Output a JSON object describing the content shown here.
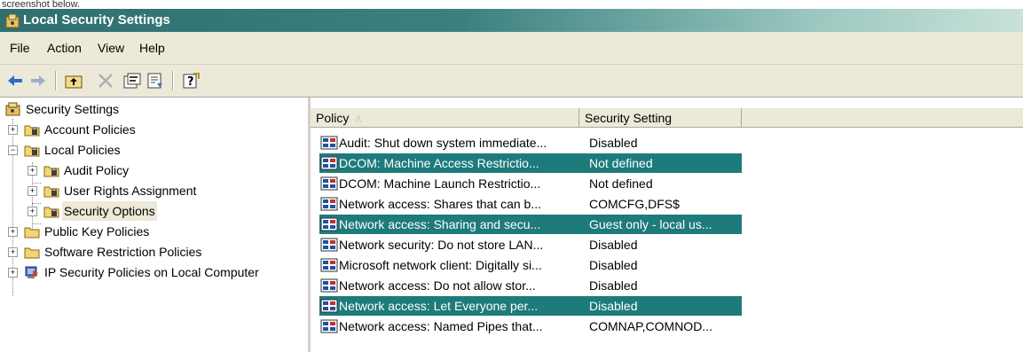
{
  "caption": "screenshot below.",
  "window": {
    "title": "Local Security Settings"
  },
  "menu": [
    "File",
    "Action",
    "View",
    "Help"
  ],
  "toolbar": {
    "buttons": [
      "back-icon",
      "forward-icon",
      "up-folder-icon",
      "delete-icon",
      "properties-icon",
      "export-list-icon",
      "help-icon"
    ]
  },
  "tree": {
    "items": [
      {
        "label": "Security Settings",
        "icon": "security-settings-icon"
      },
      {
        "label": "Account Policies",
        "icon": "folder-policy-icon",
        "expander": "+"
      },
      {
        "label": "Local Policies",
        "icon": "folder-policy-icon",
        "expander": "−"
      },
      {
        "label": "Audit Policy",
        "icon": "folder-policy-icon",
        "expander": "+"
      },
      {
        "label": "User Rights Assignment",
        "icon": "folder-policy-icon",
        "expander": "+"
      },
      {
        "label": "Security Options",
        "icon": "folder-policy-icon",
        "expander": "+",
        "selected": true
      },
      {
        "label": "Public Key Policies",
        "icon": "folder-icon",
        "expander": "+"
      },
      {
        "label": "Software Restriction Policies",
        "icon": "folder-icon",
        "expander": "+"
      },
      {
        "label": "IP Security Policies on Local Computer",
        "icon": "ip-security-icon",
        "expander": "+"
      }
    ]
  },
  "list": {
    "columns": [
      "Policy",
      "Security Setting"
    ],
    "sort_indicator": "/\\",
    "rows": [
      {
        "policy": "Audit: Shut down system immediate...",
        "setting": "Disabled",
        "highlighted": false
      },
      {
        "policy": "DCOM: Machine Access Restrictio...",
        "setting": "Not defined",
        "highlighted": true
      },
      {
        "policy": "DCOM: Machine Launch Restrictio...",
        "setting": "Not defined",
        "highlighted": false
      },
      {
        "policy": "Network access: Shares that can b...",
        "setting": "COMCFG,DFS$",
        "highlighted": false
      },
      {
        "policy": "Network access: Sharing and secu...",
        "setting": "Guest only - local us...",
        "highlighted": true
      },
      {
        "policy": "Network security: Do not store LAN...",
        "setting": "Disabled",
        "highlighted": false
      },
      {
        "policy": "Microsoft network client: Digitally si...",
        "setting": "Disabled",
        "highlighted": false
      },
      {
        "policy": "Network access: Do not allow stor...",
        "setting": "Disabled",
        "highlighted": false
      },
      {
        "policy": "Network access: Let Everyone per...",
        "setting": "Disabled",
        "highlighted": true
      },
      {
        "policy": "Network access: Named Pipes that...",
        "setting": "COMNAP,COMNOD...",
        "highlighted": false
      }
    ]
  },
  "colors": {
    "titlebar": "#2f6f6f",
    "highlight": "#1e7b7b",
    "chrome": "#ece9d8"
  }
}
